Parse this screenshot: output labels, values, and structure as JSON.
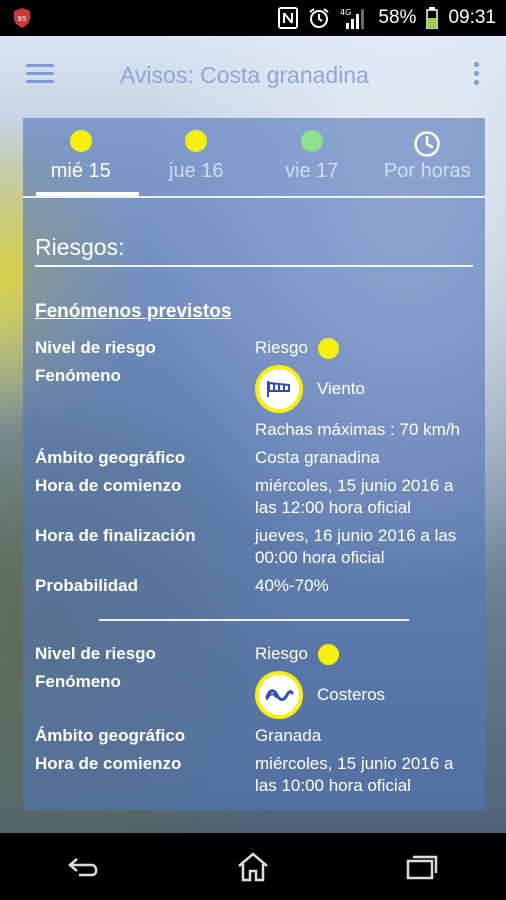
{
  "status": {
    "battery_percent": "58%",
    "time": "09:31",
    "network": "4G"
  },
  "toolbar": {
    "title": "Avisos: Costa granadina"
  },
  "tabs": [
    {
      "label": "mié 15",
      "dot_color": "#f7f00f"
    },
    {
      "label": "jue 16",
      "dot_color": "#f7f00f"
    },
    {
      "label": "vie 17",
      "dot_color": "#8fe08f"
    },
    {
      "label": "Por horas",
      "icon": "clock-icon"
    }
  ],
  "content": {
    "riesgos_title": "Riesgos:",
    "section_title": "Fenómenos previstos",
    "warning1": {
      "nivel_label": "Nivel de riesgo",
      "nivel_value": "Riesgo",
      "fenomeno_label": "Fenómeno",
      "fenomeno_value": "Viento",
      "fenomeno_icon": "wind-icon",
      "detalle": "Rachas máximas : 70 km/h",
      "ambito_label": "Ámbito geográfico",
      "ambito_value": "Costa granadina",
      "comienzo_label": "Hora de comienzo",
      "comienzo_value": "miércoles, 15 junio 2016 a las 12:00 hora oficial",
      "fin_label": "Hora de finalización",
      "fin_value": "jueves, 16 junio 2016 a las 00:00 hora oficial",
      "prob_label": "Probabilidad",
      "prob_value": "40%-70%"
    },
    "warning2": {
      "nivel_label": "Nivel de riesgo",
      "nivel_value": "Riesgo",
      "fenomeno_label": "Fenómeno",
      "fenomeno_value": "Costeros",
      "fenomeno_icon": "wave-icon",
      "ambito_label": "Ámbito geográfico",
      "ambito_value": "Granada",
      "comienzo_label": "Hora de comienzo",
      "comienzo_value": "miércoles, 15 junio 2016 a las 10:00 hora oficial"
    }
  },
  "colors": {
    "risk_yellow": "#f7f00f",
    "panel_blue": "#5476ba"
  }
}
